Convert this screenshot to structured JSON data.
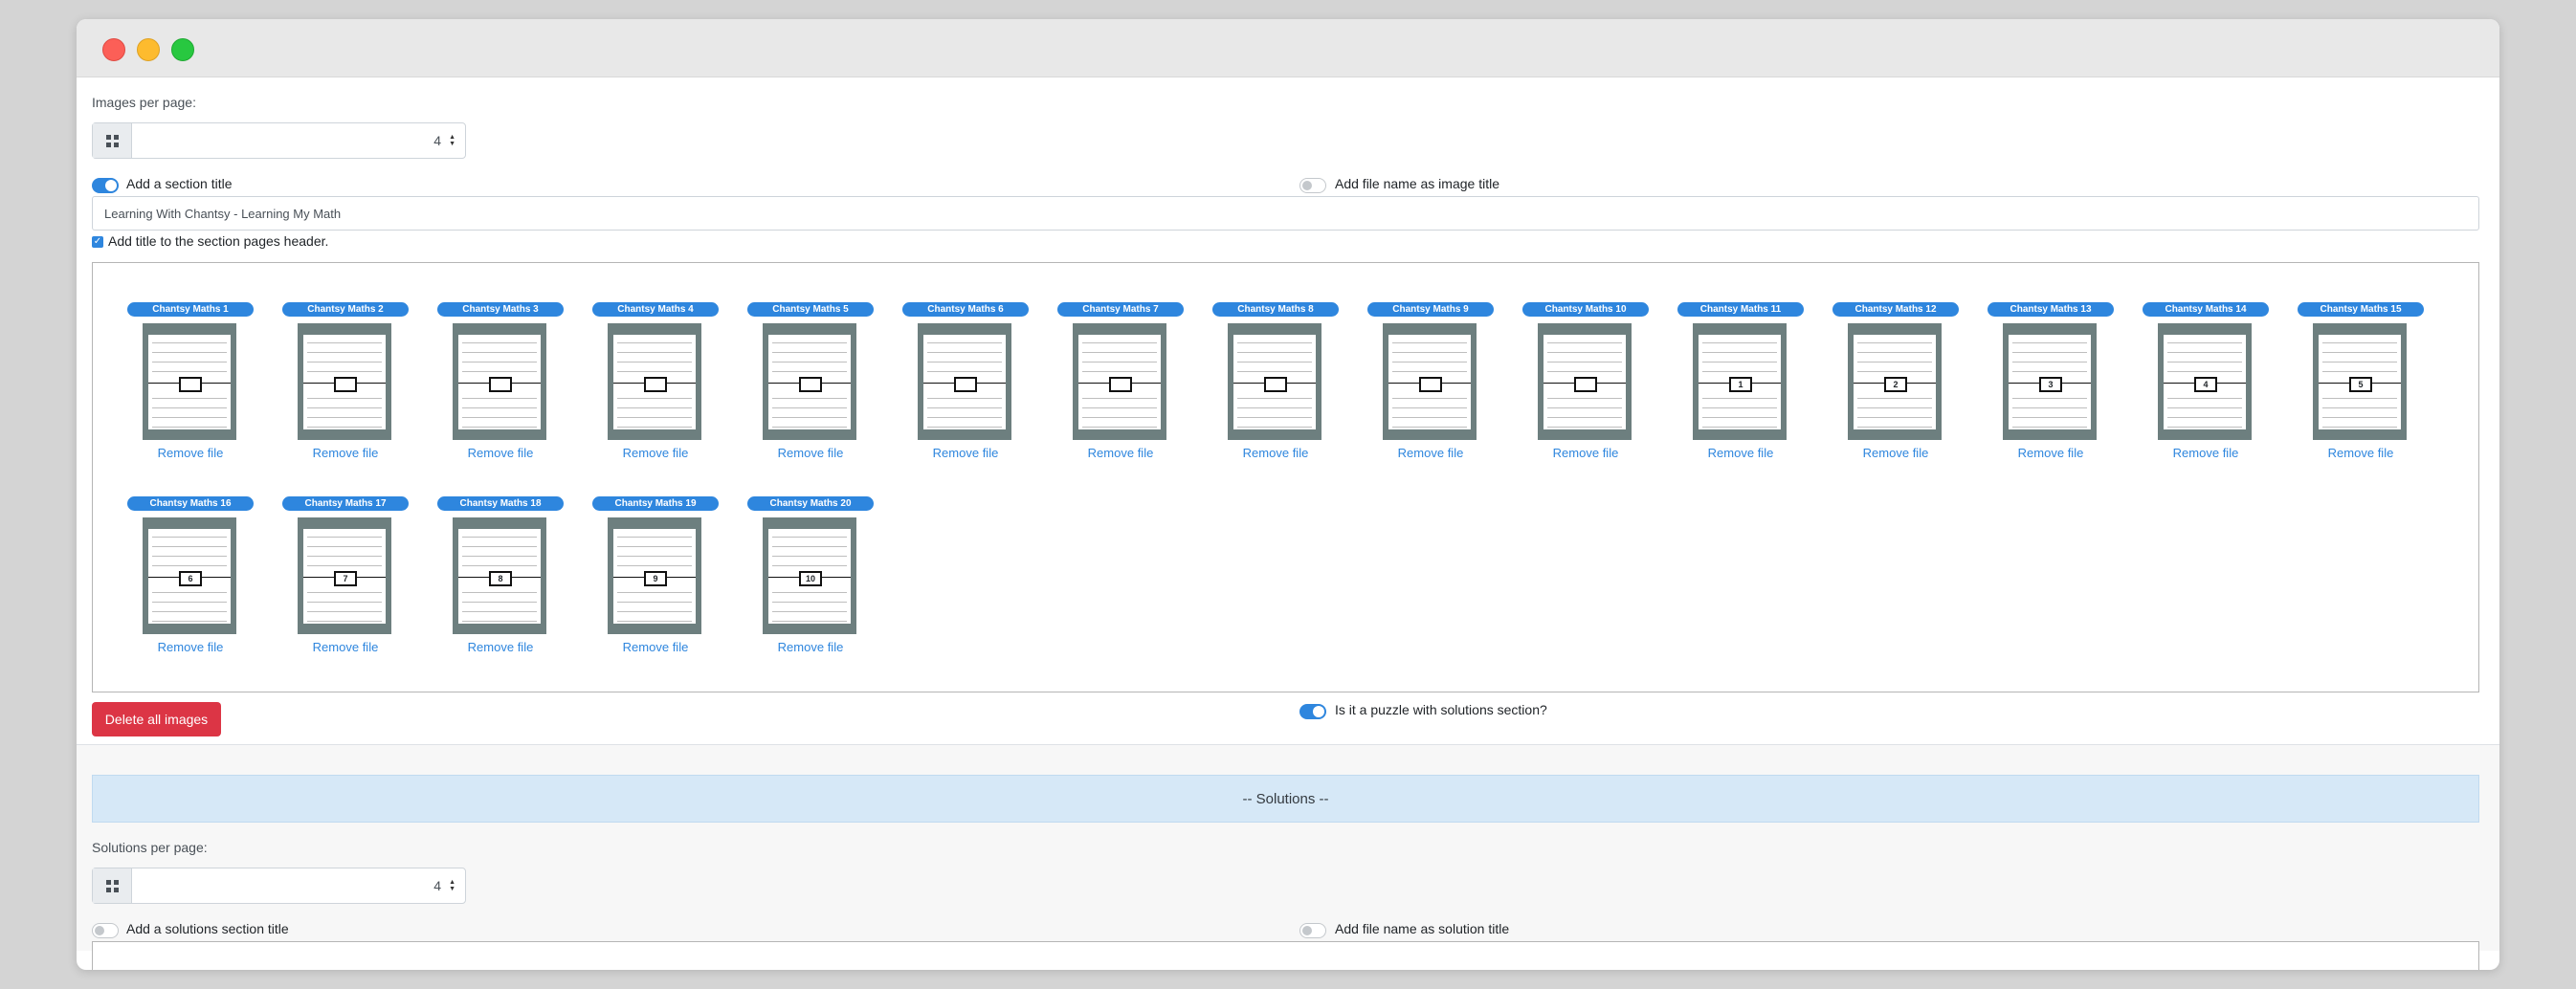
{
  "images_per_page": {
    "label": "Images per page:",
    "value": "4"
  },
  "section_title_toggle": {
    "label": "Add a section title",
    "on": true
  },
  "file_name_title_toggle": {
    "label": "Add file name as image title",
    "on": false
  },
  "section_title_input": {
    "value": "Learning With Chantsy - Learning My Math"
  },
  "header_checkbox": {
    "label": "Add title to the section pages header.",
    "checked": true
  },
  "images": [
    {
      "name": "Chantsy Maths 1",
      "box": "",
      "remove": "Remove file"
    },
    {
      "name": "Chantsy Maths 2",
      "box": "",
      "remove": "Remove file"
    },
    {
      "name": "Chantsy Maths 3",
      "box": "",
      "remove": "Remove file"
    },
    {
      "name": "Chantsy Maths 4",
      "box": "",
      "remove": "Remove file"
    },
    {
      "name": "Chantsy Maths 5",
      "box": "",
      "remove": "Remove file"
    },
    {
      "name": "Chantsy Maths 6",
      "box": "",
      "remove": "Remove file"
    },
    {
      "name": "Chantsy Maths 7",
      "box": "",
      "remove": "Remove file"
    },
    {
      "name": "Chantsy Maths 8",
      "box": "",
      "remove": "Remove file"
    },
    {
      "name": "Chantsy Maths 9",
      "box": "",
      "remove": "Remove file"
    },
    {
      "name": "Chantsy Maths 10",
      "box": "",
      "remove": "Remove file"
    },
    {
      "name": "Chantsy Maths 11",
      "box": "1",
      "remove": "Remove file"
    },
    {
      "name": "Chantsy Maths 12",
      "box": "2",
      "remove": "Remove file"
    },
    {
      "name": "Chantsy Maths 13",
      "box": "3",
      "remove": "Remove file"
    },
    {
      "name": "Chantsy Maths 14",
      "box": "4",
      "remove": "Remove file"
    },
    {
      "name": "Chantsy Maths 15",
      "box": "5",
      "remove": "Remove file"
    },
    {
      "name": "Chantsy Maths 16",
      "box": "6",
      "remove": "Remove file"
    },
    {
      "name": "Chantsy Maths 17",
      "box": "7",
      "remove": "Remove file"
    },
    {
      "name": "Chantsy Maths 18",
      "box": "8",
      "remove": "Remove file"
    },
    {
      "name": "Chantsy Maths 19",
      "box": "9",
      "remove": "Remove file"
    },
    {
      "name": "Chantsy Maths 20",
      "box": "10",
      "remove": "Remove file"
    }
  ],
  "delete_all_button": "Delete all images",
  "puzzle_toggle": {
    "label": "Is it a puzzle with solutions section?",
    "on": true
  },
  "solutions_header": "-- Solutions --",
  "solutions_per_page": {
    "label": "Solutions per page:",
    "value": "4"
  },
  "solutions_title_toggle": {
    "label": "Add a solutions section title",
    "on": false
  },
  "solution_file_name_toggle": {
    "label": "Add file name as solution title",
    "on": false
  }
}
